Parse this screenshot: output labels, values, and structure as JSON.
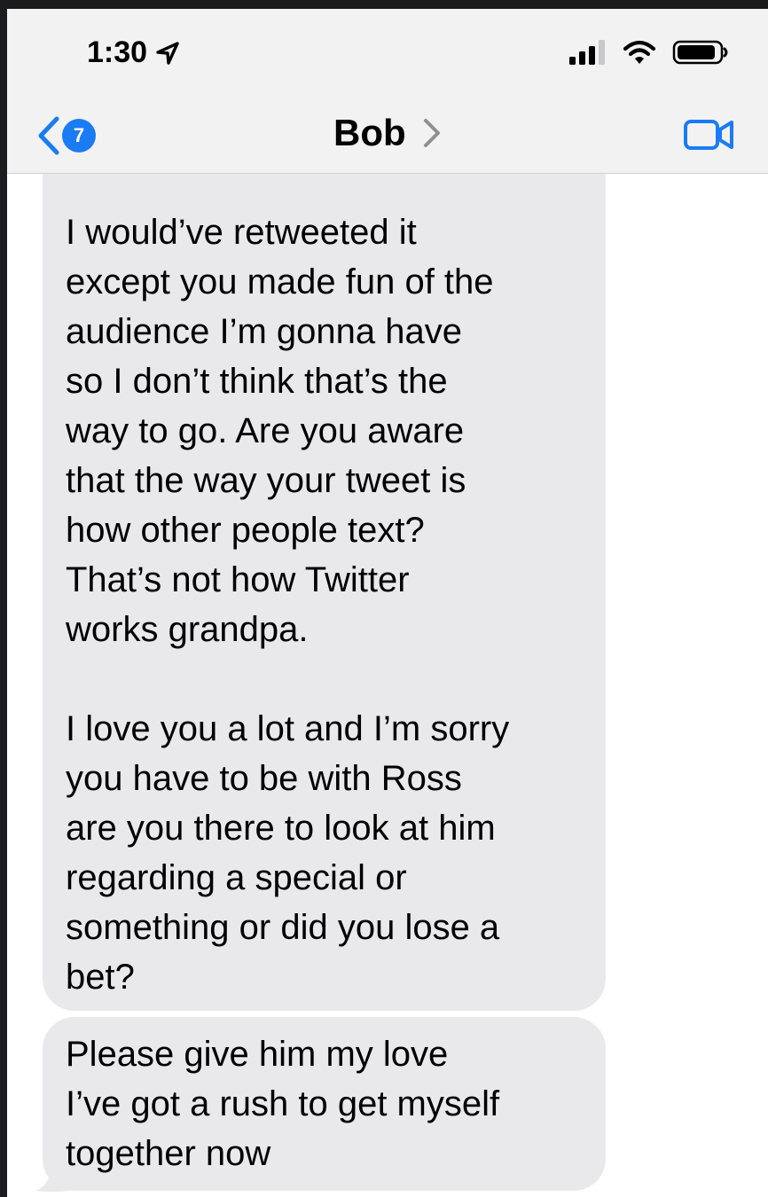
{
  "status_bar": {
    "time": "1:30",
    "location_icon": "location-arrow-icon",
    "signal_icon": "cellular-signal-icon",
    "wifi_icon": "wifi-icon",
    "battery_icon": "battery-icon"
  },
  "nav": {
    "back_icon": "chevron-left-icon",
    "unread_count": "7",
    "contact_name": "Bob",
    "contact_chevron_icon": "chevron-right-icon",
    "video_icon": "video-camera-icon"
  },
  "messages": [
    {
      "sender": "incoming",
      "text": "I would’ve retweeted it\nexcept you made fun of the\naudience I’m gonna have\nso I don’t think that’s the\nway to go. Are you aware\nthat the way your tweet is\nhow other people text?\nThat’s not how Twitter\nworks grandpa.\n\nI love you a lot and I’m sorry\nyou have to be with Ross\nare you there to look at him\nregarding a special or\nsomething or did you lose a\nbet?"
    },
    {
      "sender": "incoming",
      "text": "Please give him my love\nI’ve got a rush to get myself\ntogether now"
    }
  ],
  "colors": {
    "accent": "#1a7cf5",
    "bubble_incoming": "#e9e9eb",
    "nav_background": "#f2f2f3"
  }
}
